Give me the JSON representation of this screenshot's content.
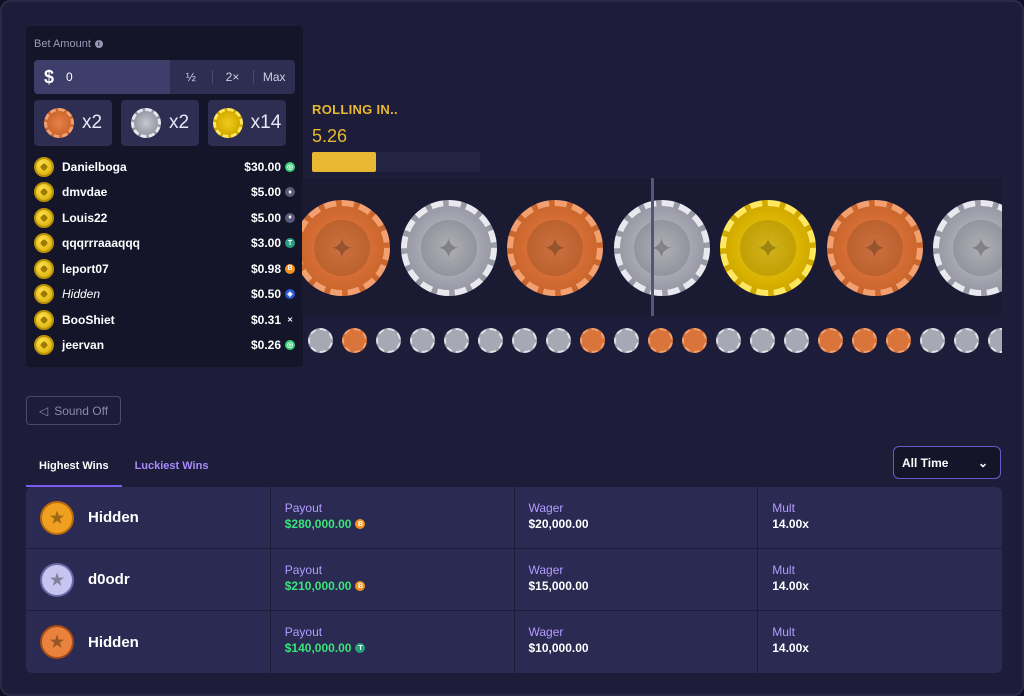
{
  "bet": {
    "label": "Bet Amount",
    "value": "0",
    "currency_symbol": "$",
    "half_label": "½",
    "double_label": "2×",
    "max_label": "Max"
  },
  "coin_bets": [
    {
      "type": "bronze",
      "multiplier": "x2"
    },
    {
      "type": "silver",
      "multiplier": "x2"
    },
    {
      "type": "gold",
      "multiplier": "x14"
    }
  ],
  "players": [
    {
      "name": "Danielboga",
      "amount": "$30.00",
      "currency_color": "#3ad07a",
      "currency_glyph": "◎",
      "italic": false
    },
    {
      "name": "dmvdae",
      "amount": "$5.00",
      "currency_color": "#5a5a7a",
      "currency_glyph": "♦",
      "italic": false
    },
    {
      "name": "Louis22",
      "amount": "$5.00",
      "currency_color": "#5a5a7a",
      "currency_glyph": "♦",
      "italic": false
    },
    {
      "name": "qqqrrraaaqqq",
      "amount": "$3.00",
      "currency_color": "#26a17b",
      "currency_glyph": "T",
      "italic": false
    },
    {
      "name": "leport07",
      "amount": "$0.98",
      "currency_color": "#f7931a",
      "currency_glyph": "B",
      "italic": false
    },
    {
      "name": "Hidden",
      "amount": "$0.50",
      "currency_color": "#2a5ada",
      "currency_glyph": "◈",
      "italic": true
    },
    {
      "name": "BooShiet",
      "amount": "$0.31",
      "currency_color": "#15152a",
      "currency_glyph": "✕",
      "italic": false
    },
    {
      "name": "jeervan",
      "amount": "$0.26",
      "currency_color": "#3ad07a",
      "currency_glyph": "◎",
      "italic": false
    }
  ],
  "rolling": {
    "label": "ROLLING IN..",
    "countdown": "5.26",
    "progress": 0.38
  },
  "reel_coins": [
    "bronze",
    "silver",
    "bronze",
    "silver",
    "gold",
    "bronze",
    "silver"
  ],
  "history_coins": [
    "silver",
    "bronze",
    "silver",
    "silver",
    "silver",
    "silver",
    "silver",
    "silver",
    "bronze",
    "silver",
    "bronze",
    "bronze",
    "silver",
    "silver",
    "silver",
    "bronze",
    "bronze",
    "bronze",
    "silver",
    "silver",
    "silver"
  ],
  "sound": {
    "label": "Sound Off"
  },
  "tabs": {
    "highest": "Highest Wins",
    "luckiest": "Luckiest Wins"
  },
  "time_filter": {
    "value": "All Time"
  },
  "wins": [
    {
      "user": "Hidden",
      "avatar": "orange",
      "payout_label": "Payout",
      "payout": "$280,000.00",
      "payout_currency_color": "#f7931a",
      "payout_currency_glyph": "B",
      "wager_label": "Wager",
      "wager": "$20,000.00",
      "mult_label": "Mult",
      "mult": "14.00x"
    },
    {
      "user": "d0odr",
      "avatar": "lav",
      "payout_label": "Payout",
      "payout": "$210,000.00",
      "payout_currency_color": "#f7931a",
      "payout_currency_glyph": "B",
      "wager_label": "Wager",
      "wager": "$15,000.00",
      "mult_label": "Mult",
      "mult": "14.00x"
    },
    {
      "user": "Hidden",
      "avatar": "copper",
      "payout_label": "Payout",
      "payout": "$140,000.00",
      "payout_currency_color": "#26a17b",
      "payout_currency_glyph": "T",
      "wager_label": "Wager",
      "wager": "$10,000.00",
      "mult_label": "Mult",
      "mult": "14.00x"
    }
  ]
}
